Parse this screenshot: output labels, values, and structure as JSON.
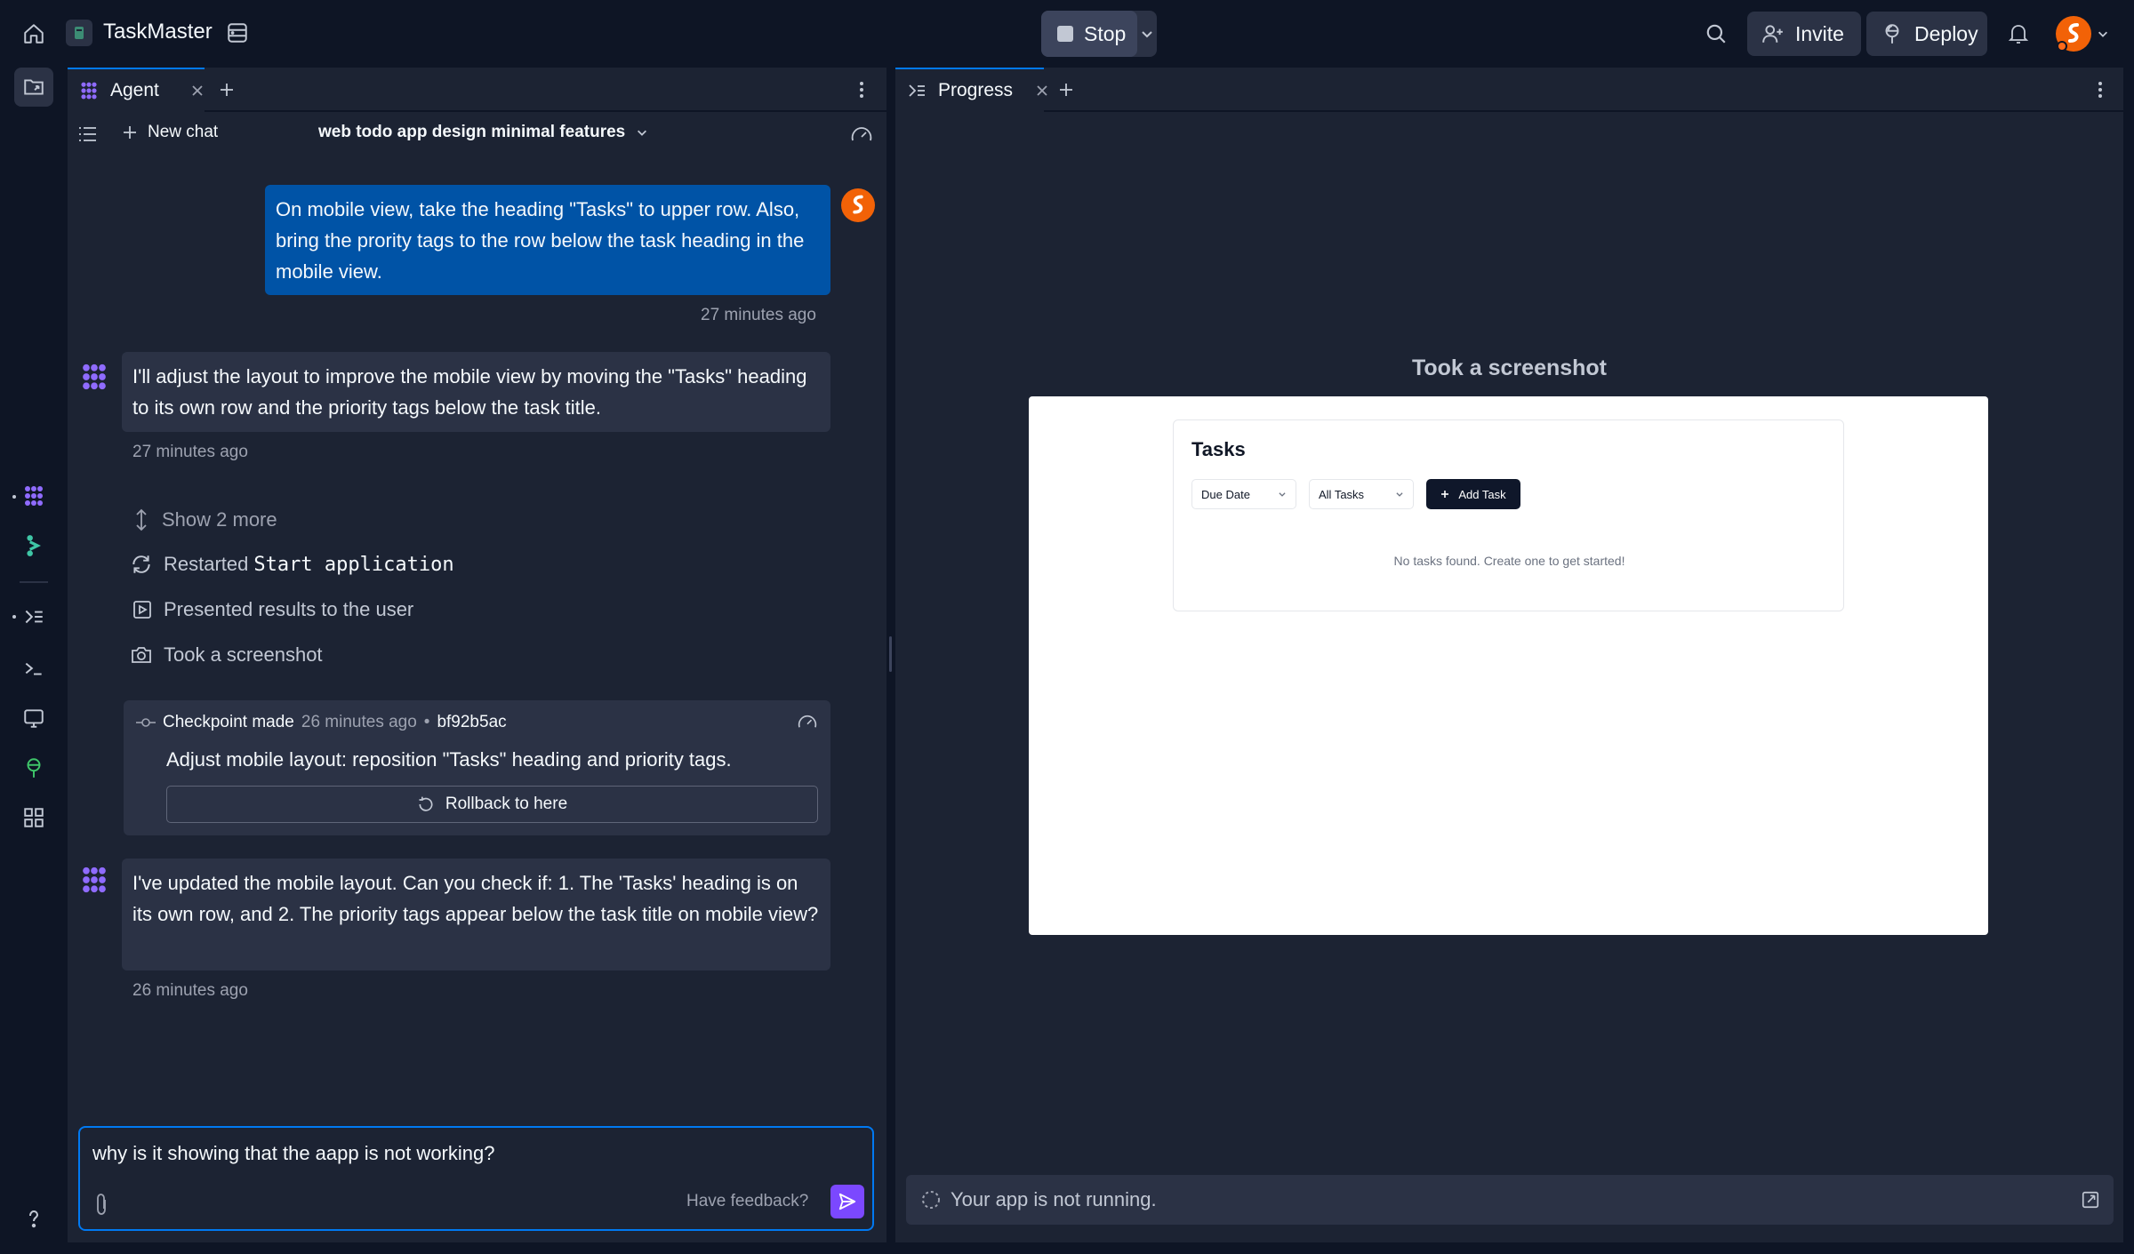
{
  "topbar": {
    "app_name": "TaskMaster",
    "stop_label": "Stop",
    "invite_label": "Invite",
    "deploy_label": "Deploy"
  },
  "left_panel": {
    "tab_label": "Agent",
    "new_chat_label": "New chat",
    "chat_title": "web todo app design minimal features",
    "messages": {
      "user_1": "On mobile view, take the heading \"Tasks\" to upper row. Also, bring the prority tags to the row below the task heading in the mobile view.",
      "user_1_time": "27 minutes ago",
      "agent_1": "I'll adjust the layout to improve the mobile view by moving the \"Tasks\" heading to its own row and the priority tags below the task title.",
      "agent_1_time": "27 minutes ago",
      "agent_2": "I've updated the mobile layout. Can you check if: 1. The 'Tasks' heading is on its own row, and 2. The priority tags appear below the task title on mobile view?",
      "agent_2_time": "26 minutes ago"
    },
    "actions": {
      "show_more": "Show 2 more",
      "restarted_prefix": "Restarted",
      "restarted_code": "Start application",
      "presented": "Presented results to the user",
      "screenshot": "Took a screenshot"
    },
    "checkpoint": {
      "label": "Checkpoint made",
      "time": "26 minutes ago",
      "bullet": "•",
      "hash": "bf92b5ac",
      "description": "Adjust mobile layout: reposition \"Tasks\" heading and priority tags.",
      "rollback_label": "Rollback to here"
    },
    "input": {
      "value": "why is it showing that the aapp is not working?",
      "feedback_label": "Have feedback?"
    }
  },
  "right_panel": {
    "tab_label": "Progress",
    "screenshot_title": "Took a screenshot",
    "preview": {
      "heading": "Tasks",
      "sort_select": "Due Date",
      "filter_select": "All Tasks",
      "add_task": "Add Task",
      "empty_message": "No tasks found. Create one to get started!"
    },
    "status_text": "Your app is not running."
  },
  "colors": {
    "background": "#0e1525",
    "panel": "#1c2333",
    "surface": "#2b3245",
    "accent_blue": "#0079f2",
    "user_bubble": "#0053a6",
    "send_button": "#7b48ff",
    "brand_orange": "#f26207"
  }
}
